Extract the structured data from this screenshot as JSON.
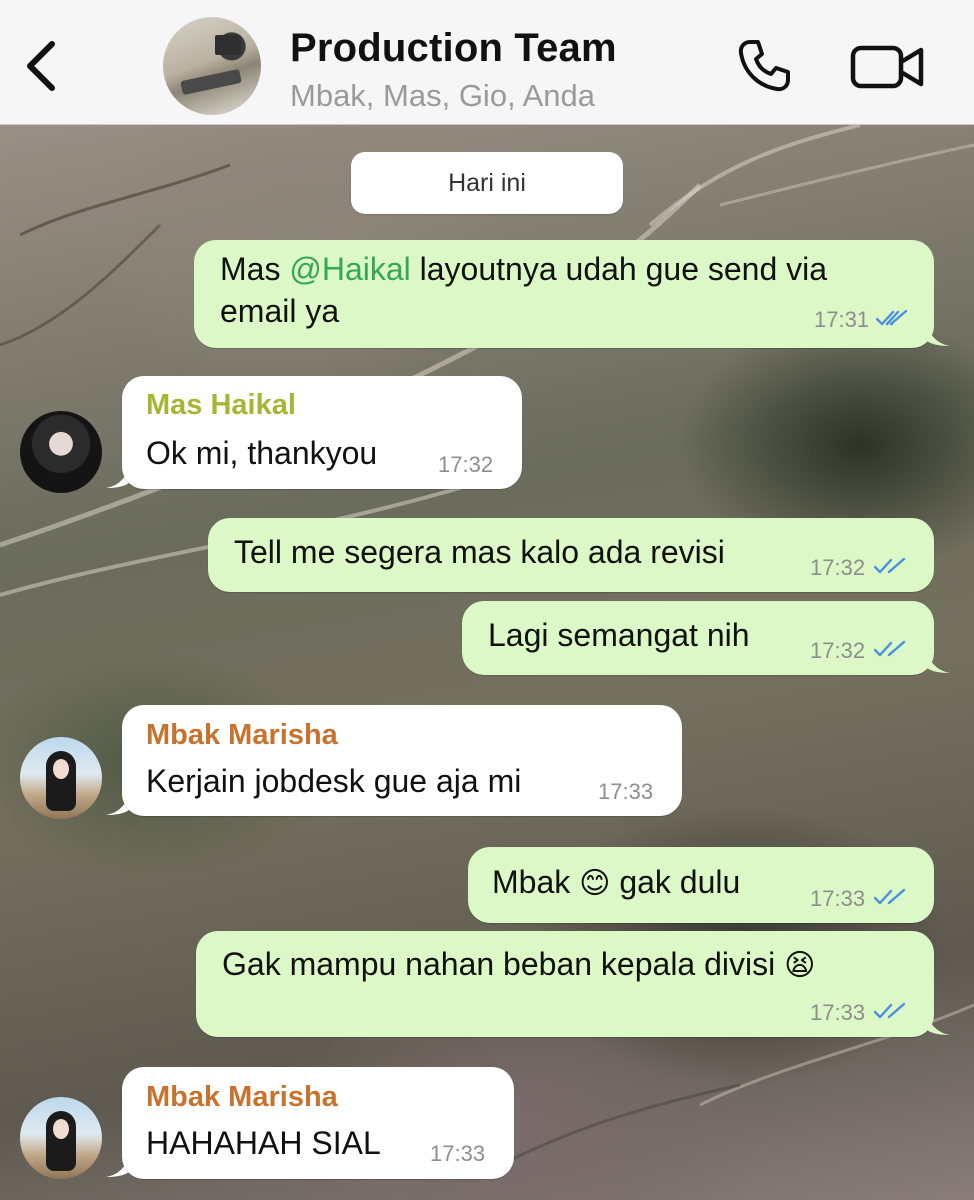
{
  "header": {
    "title": "Production Team",
    "subtitle": "Mbak, Mas, Gio, Anda",
    "back_icon": "chevron-left-icon",
    "call_icon": "phone-icon",
    "video_icon": "video-camera-icon"
  },
  "date_chip": "Hari ini",
  "colors": {
    "outgoing_bubble": "#dcf8c6",
    "incoming_bubble": "#ffffff",
    "read_ticks": "#4a90e2",
    "sender_haikal": "#a8b534",
    "sender_marisha": "#c7732d",
    "mention": "#34a853"
  },
  "messages": [
    {
      "direction": "out",
      "text_pre": "Mas ",
      "mention": "@Haikal",
      "text_line1_rest": " layoutnya udah gue send via",
      "text_line2": "email ya",
      "time": "17:31"
    },
    {
      "direction": "in",
      "sender": "Mas Haikal",
      "text": "Ok mi, thankyou",
      "time": "17:32"
    },
    {
      "direction": "out",
      "text": "Tell me segera mas kalo ada revisi",
      "time": "17:32"
    },
    {
      "direction": "out",
      "text": "Lagi semangat nih",
      "time": "17:32"
    },
    {
      "direction": "in",
      "sender": "Mbak Marisha",
      "text": "Kerjain jobdesk gue aja mi",
      "time": "17:33"
    },
    {
      "direction": "out",
      "text_pre": "Mbak ",
      "emoji": "😊",
      "text_post": " gak dulu",
      "time": "17:33"
    },
    {
      "direction": "out",
      "text": "Gak mampu nahan beban kepala divisi ",
      "emoji": "😫",
      "time": "17:33"
    },
    {
      "direction": "in",
      "sender": "Mbak Marisha",
      "text": "HAHAHAH SIAL",
      "time": "17:33"
    }
  ]
}
